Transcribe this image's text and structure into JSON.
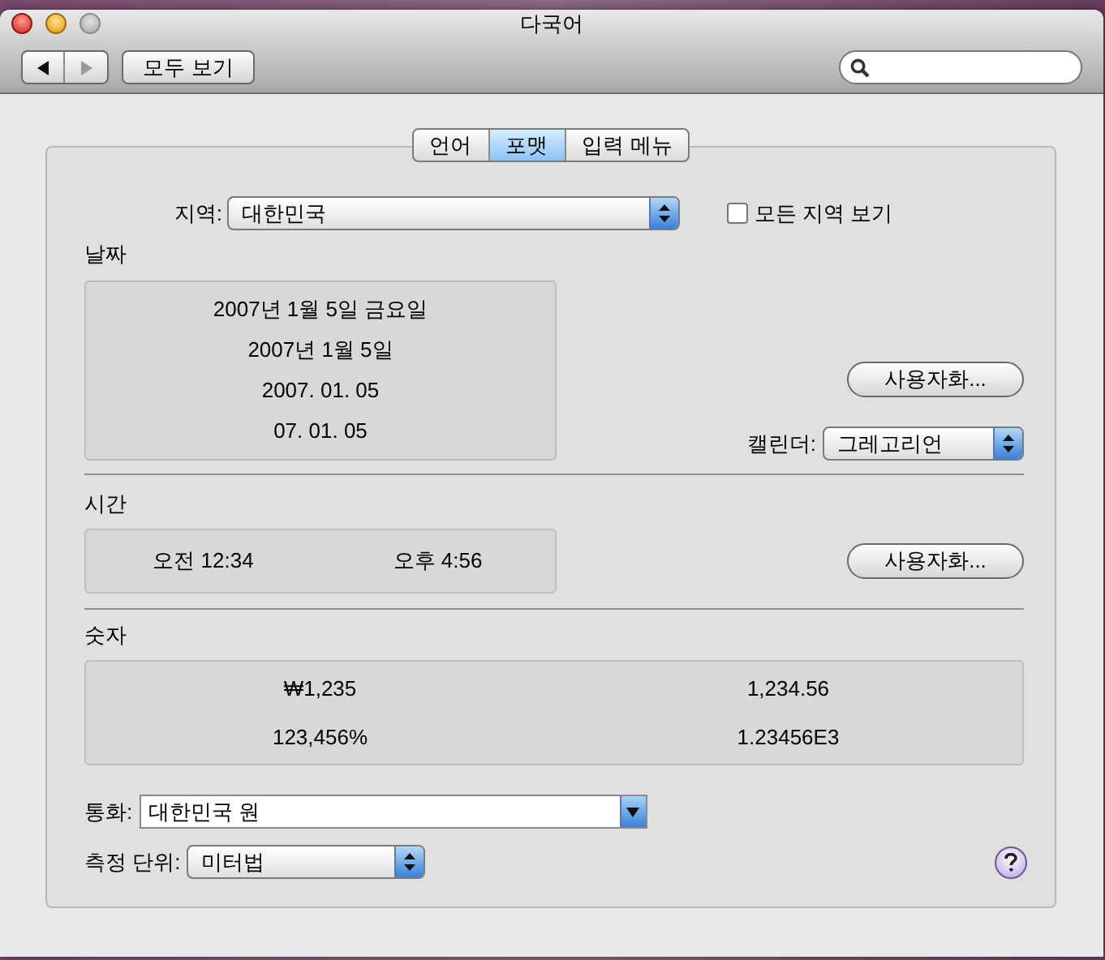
{
  "window": {
    "title": "다국어",
    "show_all_button": "모두 보기"
  },
  "tabs": [
    {
      "label": "언어",
      "selected": false
    },
    {
      "label": "포맷",
      "selected": true
    },
    {
      "label": "입력 메뉴",
      "selected": false
    }
  ],
  "region": {
    "label": "지역:",
    "value": "대한민국"
  },
  "show_all_regions": {
    "label": "모든 지역 보기",
    "checked": false
  },
  "date": {
    "heading": "날짜",
    "samples": [
      "2007년 1월 5일 금요일",
      "2007년 1월 5일",
      "2007. 01. 05",
      "07. 01. 05"
    ],
    "customize_button": "사용자화...",
    "calendar": {
      "label": "캘린더:",
      "value": "그레고리언"
    }
  },
  "time": {
    "heading": "시간",
    "samples": [
      "오전 12:34",
      "오후 4:56"
    ],
    "customize_button": "사용자화..."
  },
  "numbers": {
    "heading": "숫자",
    "samples": [
      "₩1,235",
      "1,234.56",
      "123,456%",
      "1.23456E3"
    ]
  },
  "currency": {
    "label": "통화:",
    "value": "대한민국 원"
  },
  "measurement_units": {
    "label": "측정 단위:",
    "value": "미터법"
  }
}
